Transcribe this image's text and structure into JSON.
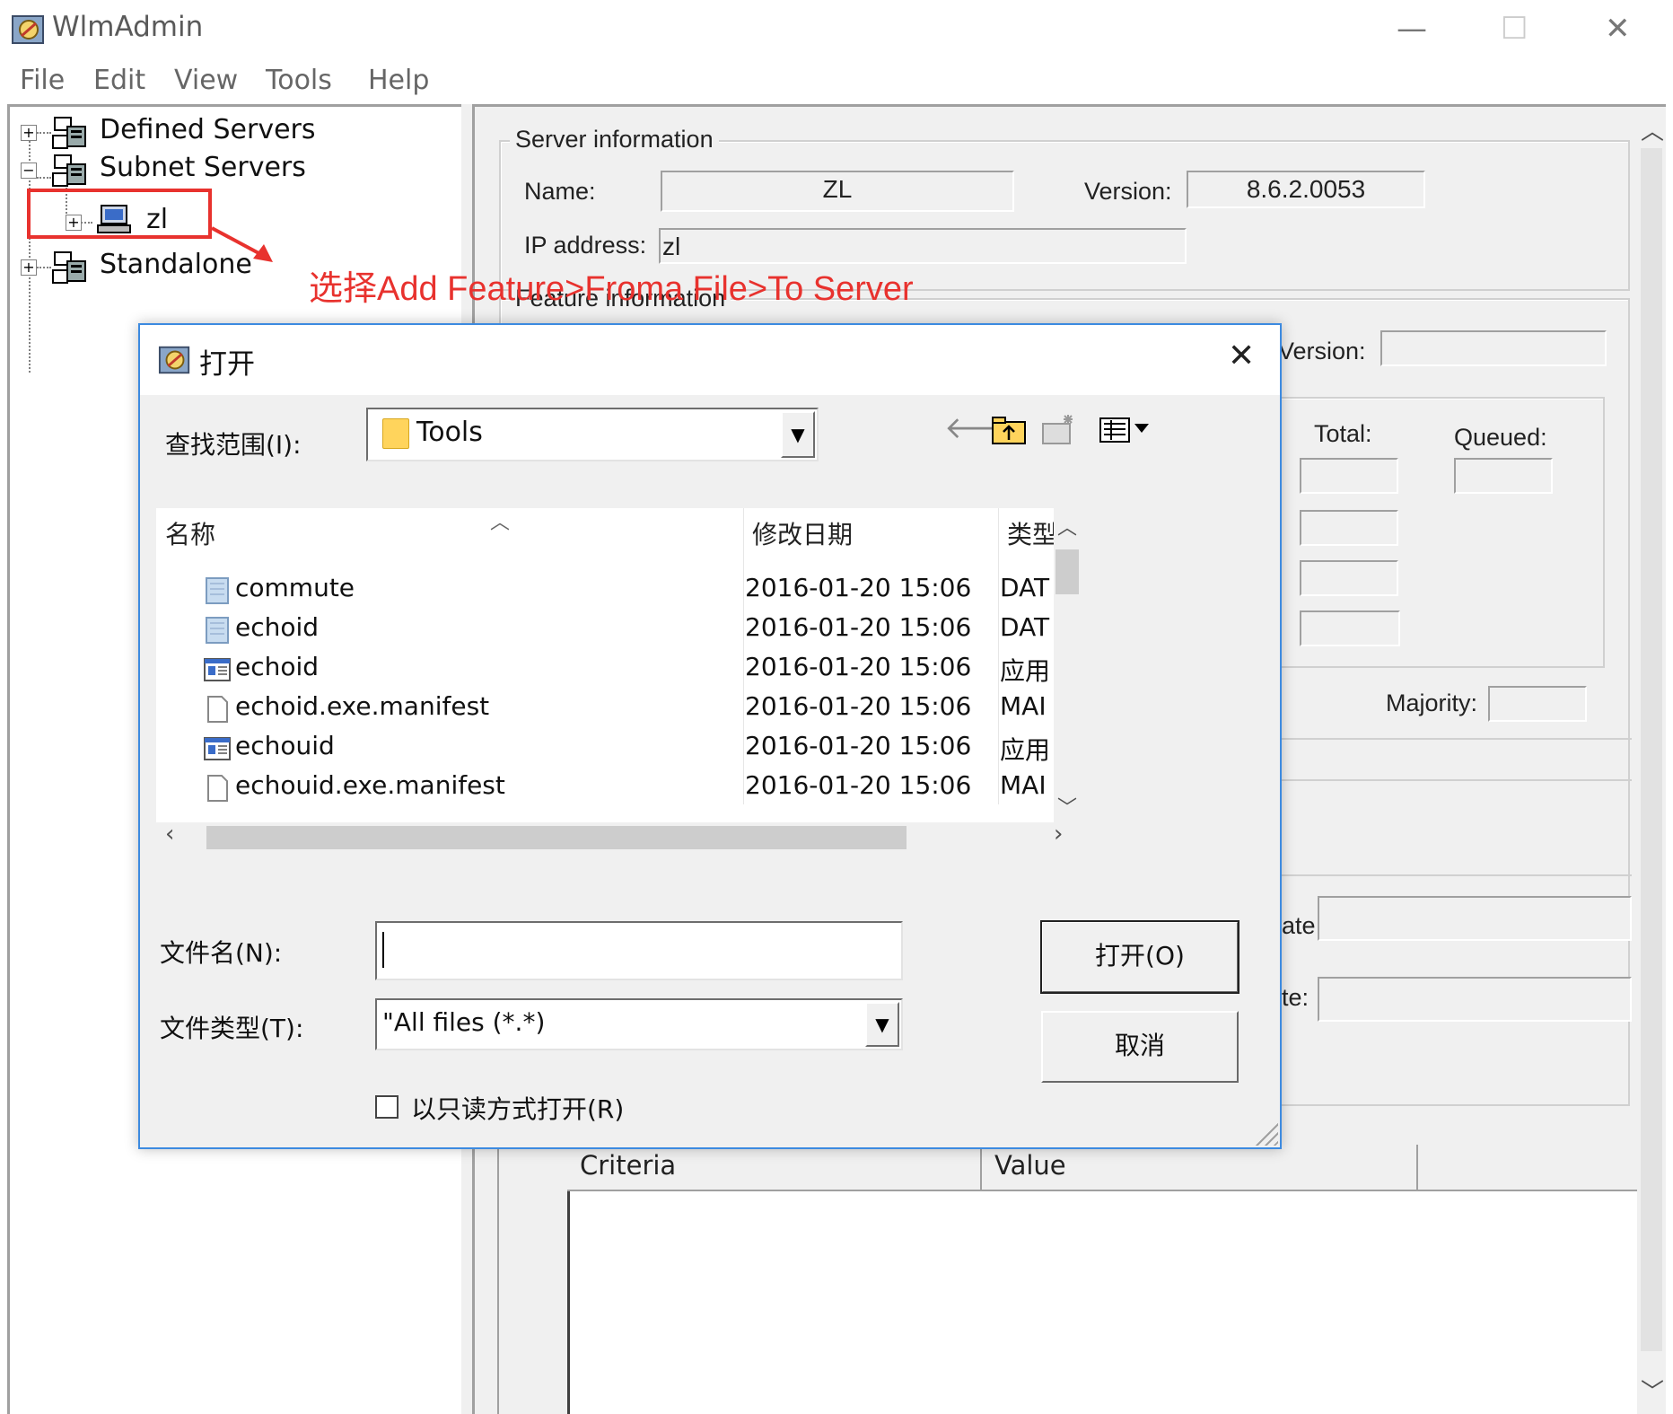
{
  "window": {
    "title": "WlmAdmin",
    "controls": {
      "minimize": "—",
      "maximize": "☐",
      "close": "✕"
    }
  },
  "menu": [
    "File",
    "Edit",
    "View",
    "Tools",
    "Help"
  ],
  "tree": {
    "defined_servers": "Defined Servers",
    "subnet_servers": "Subnet Servers",
    "zl": "zl",
    "standalone": "Standalone",
    "expand_plus": "+",
    "collapse_minus": "−"
  },
  "annotation": "选择Add Feature>Froma File>To Server",
  "server_info": {
    "group_title": "Server information",
    "name_label": "Name:",
    "name_value": "ZL",
    "version_label": "Version:",
    "version_value": "8.6.2.0053",
    "ip_label": "IP address:",
    "ip_value": "zl"
  },
  "feature_info": {
    "group_title": "Feature information",
    "version_label": "Version:",
    "total_label": "Total:",
    "queued_label": "Queued:",
    "majority_label": "Majority:",
    "partial_label_1": "ate",
    "partial_label_2": "te:"
  },
  "criteria_table": {
    "columns": [
      "Criteria",
      "Value",
      ""
    ]
  },
  "dialog": {
    "title": "打开",
    "close": "✕",
    "look_in_label": "查找范围(I):",
    "look_in_value": "Tools",
    "list_columns": {
      "name": "名称",
      "date": "修改日期",
      "type": "类型"
    },
    "files": [
      {
        "icon": "data-file-icon",
        "name": "commute",
        "date": "2016-01-20 15:06",
        "type": "DAT"
      },
      {
        "icon": "data-file-icon",
        "name": "echoid",
        "date": "2016-01-20 15:06",
        "type": "DAT"
      },
      {
        "icon": "application-icon",
        "name": "echoid",
        "date": "2016-01-20 15:06",
        "type": "应用"
      },
      {
        "icon": "blank-file-icon",
        "name": "echoid.exe.manifest",
        "date": "2016-01-20 15:06",
        "type": "MAI"
      },
      {
        "icon": "application-icon",
        "name": "echouid",
        "date": "2016-01-20 15:06",
        "type": "应用"
      },
      {
        "icon": "blank-file-icon",
        "name": "echouid.exe.manifest",
        "date": "2016-01-20 15:06",
        "type": "MAI"
      }
    ],
    "filename_label": "文件名(N):",
    "filename_value": "",
    "filetype_label": "文件类型(T):",
    "filetype_value": "\"All files (*.*)",
    "open_button": "打开(O)",
    "cancel_button": "取消",
    "readonly_label": "以只读方式打开(R)"
  }
}
